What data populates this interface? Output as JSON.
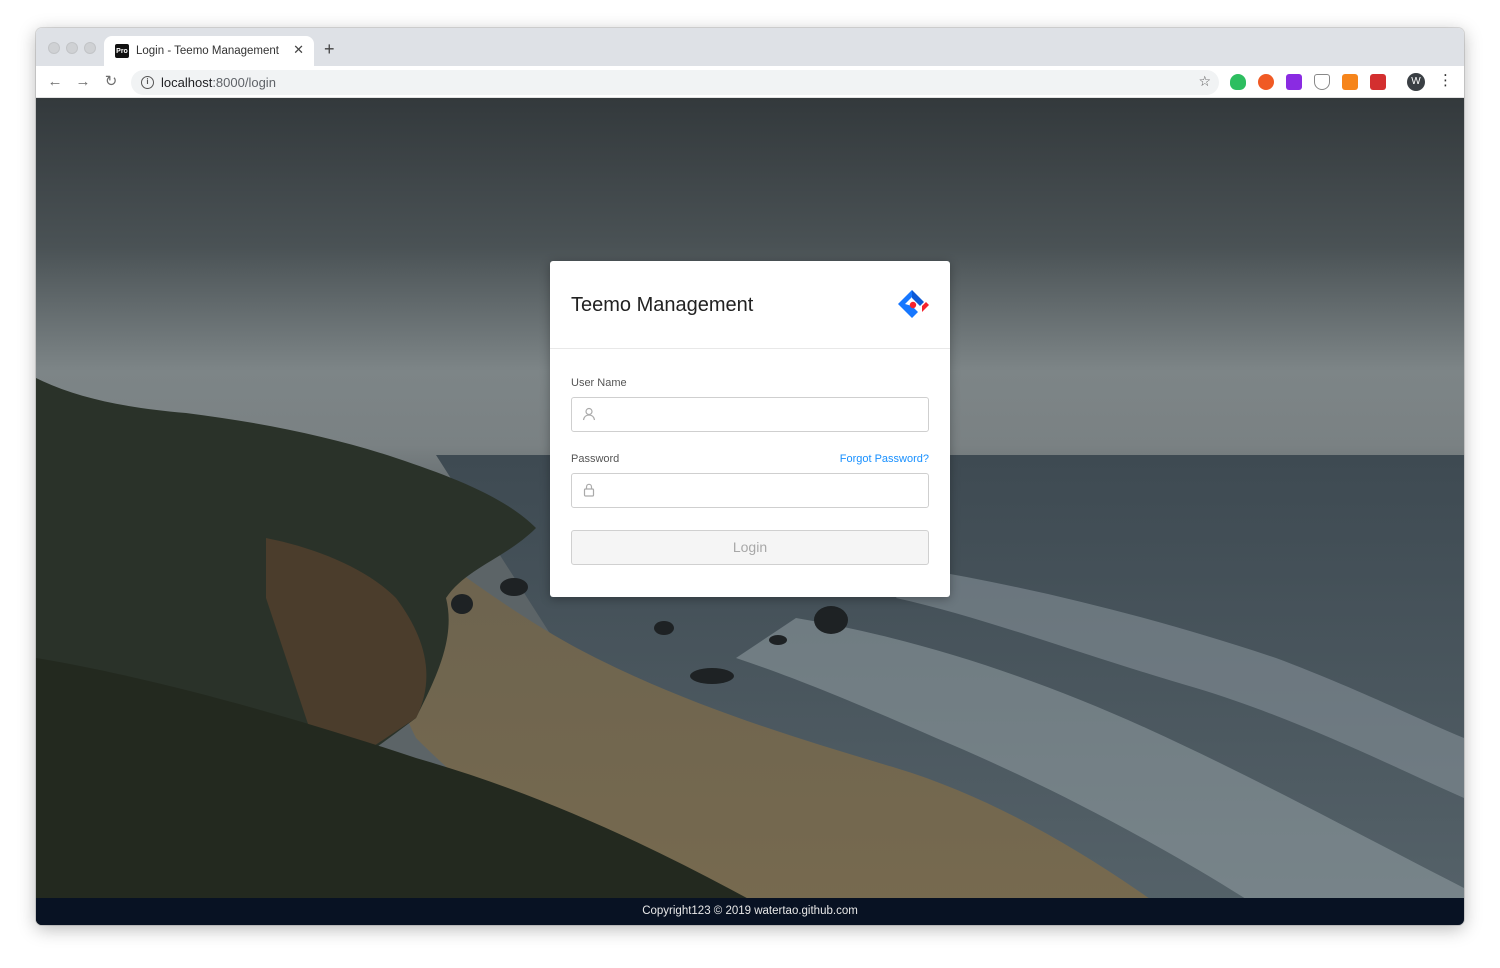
{
  "browser": {
    "tab_favicon_text": "Pro",
    "tab_title": "Login - Teemo Management",
    "tab_close_icon": "close-icon",
    "new_tab_icon": "plus-icon",
    "url_host": "localhost",
    "url_path": ":8000/login",
    "extensions": [
      "evernote-icon",
      "adblock-icon",
      "purple-extension-icon",
      "shield-extension-icon",
      "metamask-icon",
      "red-extension-icon"
    ],
    "profile_initial": "W"
  },
  "login_card": {
    "title": "Teemo Management",
    "username_label": "User Name",
    "username_value": "",
    "password_label": "Password",
    "password_value": "",
    "forgot_link": "Forgot Password?",
    "login_button": "Login"
  },
  "footer": {
    "text": "Copyright123 © 2019 watertao.github.com"
  },
  "colors": {
    "link": "#1890ff",
    "footer_bg": "#081223",
    "logo_blue": "#1677ff",
    "logo_red": "#f5222d"
  }
}
